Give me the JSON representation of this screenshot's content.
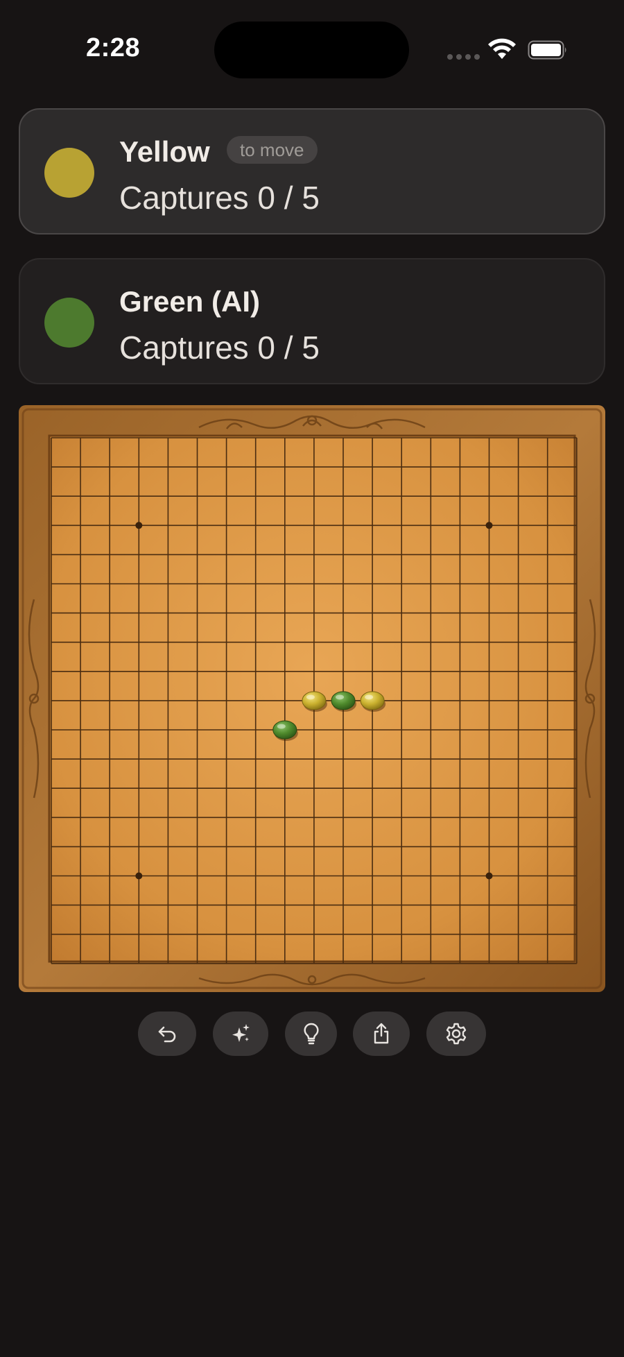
{
  "status_bar": {
    "time": "2:28"
  },
  "players": [
    {
      "name": "Yellow",
      "badge": "to move",
      "captures": "Captures 0 / 5",
      "color": "#b8a233",
      "active": true
    },
    {
      "name": "Green (AI)",
      "captures": "Captures 0 / 5",
      "color": "#4d7a2e",
      "active": false
    }
  ],
  "board": {
    "size": 19,
    "star_points": [
      [
        3,
        3
      ],
      [
        15,
        3
      ],
      [
        3,
        15
      ],
      [
        15,
        15
      ]
    ],
    "stones": [
      {
        "col": 9,
        "row": 9,
        "color": "yellow"
      },
      {
        "col": 10,
        "row": 9,
        "color": "green"
      },
      {
        "col": 11,
        "row": 9,
        "color": "yellow"
      },
      {
        "col": 8,
        "row": 10,
        "color": "green"
      }
    ]
  },
  "toolbar": [
    {
      "name": "undo-button",
      "icon": "undo-arrow-icon"
    },
    {
      "name": "ai-move-button",
      "icon": "sparkles-icon"
    },
    {
      "name": "hint-button",
      "icon": "lightbulb-icon"
    },
    {
      "name": "share-button",
      "icon": "share-icon"
    },
    {
      "name": "settings-button",
      "icon": "gear-icon"
    }
  ]
}
